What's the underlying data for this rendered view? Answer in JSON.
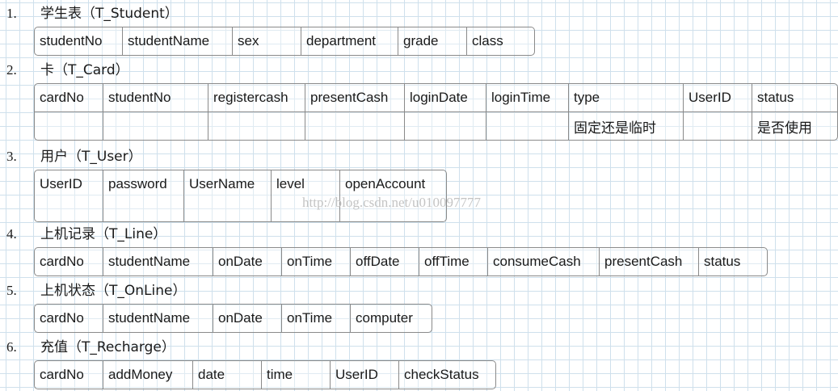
{
  "watermark": "http://blog.csdn.net/u010097777",
  "sections": [
    {
      "number": "1.",
      "title": "学生表（T_Student）",
      "columns": [
        "studentNo",
        "studentName",
        "sex",
        "department",
        "grade",
        "class"
      ]
    },
    {
      "number": "2.",
      "title": "卡（T_Card）",
      "columns": [
        "cardNo",
        "studentNo",
        "registercash",
        "presentCash",
        "loginDate",
        "loginTime",
        "type",
        "UserID",
        "status"
      ],
      "notes": [
        "",
        "",
        "",
        "",
        "",
        "",
        "固定还是临时",
        "",
        "是否使用"
      ]
    },
    {
      "number": "3.",
      "title": "用户（T_User）",
      "columns": [
        "UserID",
        "password",
        "UserName",
        "level",
        "openAccount"
      ]
    },
    {
      "number": "4.",
      "title": "上机记录（T_Line）",
      "columns": [
        "cardNo",
        "studentName",
        "onDate",
        "onTime",
        "offDate",
        "offTime",
        "consumeCash",
        "presentCash",
        "status"
      ]
    },
    {
      "number": "5.",
      "title": "上机状态（T_OnLine）",
      "columns": [
        "cardNo",
        "studentName",
        "onDate",
        "onTime",
        "computer"
      ]
    },
    {
      "number": "6.",
      "title": "充值（T_Recharge）",
      "columns": [
        "cardNo",
        "addMoney",
        "date",
        "time",
        "UserID",
        "checkStatus"
      ]
    }
  ]
}
